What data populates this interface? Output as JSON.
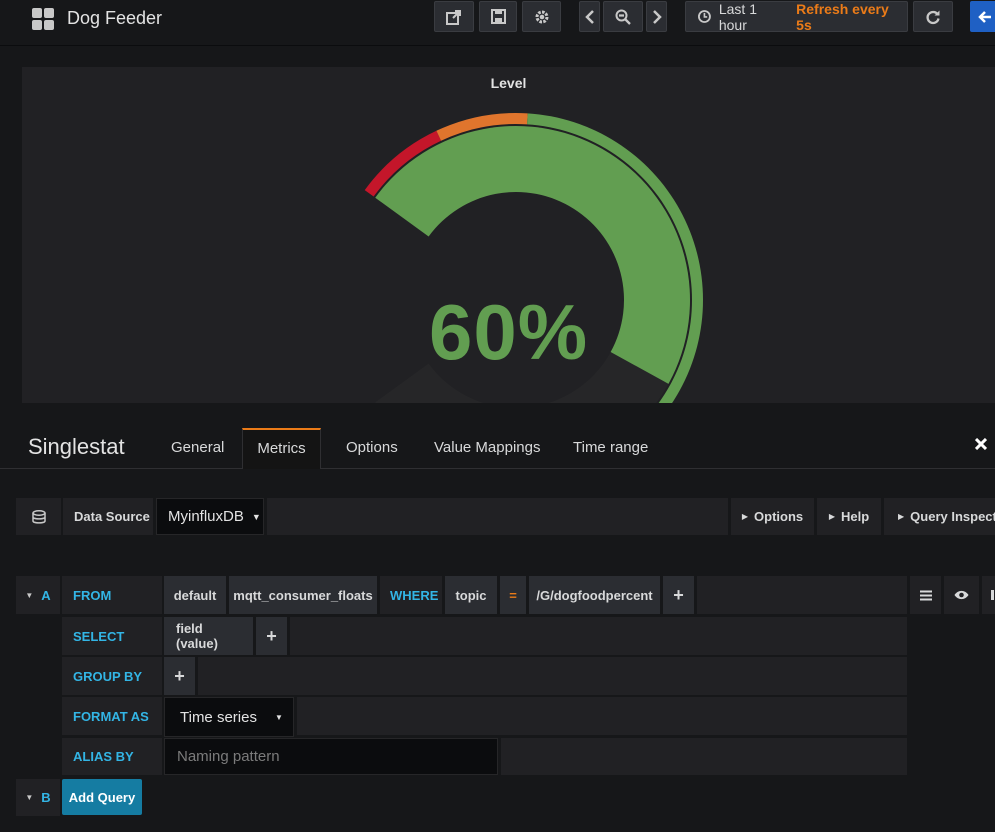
{
  "navbar": {
    "title": "Dog Feeder",
    "time_range": "Last 1 hour",
    "refresh": "Refresh every 5s"
  },
  "panel": {
    "title": "Level",
    "value_text": "60%",
    "gauge": {
      "value_fraction": 0.6,
      "thresholds": [
        {
          "from": 0,
          "to": 0.1,
          "color": "#c4162a"
        },
        {
          "from": 0.1,
          "to": 0.2,
          "color": "#e0752d"
        },
        {
          "from": 0.2,
          "to": 1.0,
          "color": "#629e51"
        }
      ],
      "value_color": "#629e51",
      "empty_color": "#262628"
    }
  },
  "editor": {
    "title": "Singlestat",
    "tabs": [
      "General",
      "Metrics",
      "Options",
      "Value Mappings",
      "Time range"
    ],
    "active_tab": "Metrics"
  },
  "datasource": {
    "label": "Data Source",
    "value": "MyinfluxDB",
    "options_label": "Options",
    "help_label": "Help",
    "inspector_label": "Query Inspector"
  },
  "query": {
    "ref_a": "A",
    "ref_b": "B",
    "from_kw": "FROM",
    "policy": "default",
    "measurement": "mqtt_consumer_floats",
    "where_kw": "WHERE",
    "tag_key": "topic",
    "operator": "=",
    "tag_value": "/G/dogfoodpercent",
    "select_kw": "SELECT",
    "select_value": "field (value)",
    "group_kw": "GROUP BY",
    "format_kw": "FORMAT AS",
    "format_value": "Time series",
    "alias_kw": "ALIAS BY",
    "alias_placeholder": "Naming pattern",
    "add_query": "Add Query",
    "plus": "+"
  }
}
